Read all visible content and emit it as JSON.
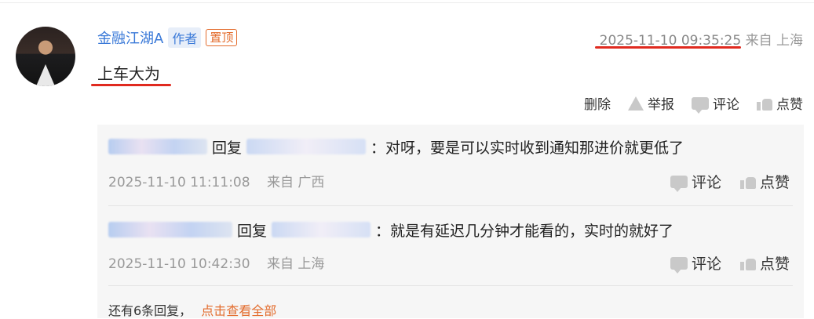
{
  "comment": {
    "author": "金融江湖A",
    "author_badge": "作者",
    "pinned_badge": "置顶",
    "time": "2025-11-10 09:35:25",
    "location": "来自 上海",
    "content": "上车大为",
    "actions": {
      "delete": "删除",
      "report": "举报",
      "comment": "评论",
      "like": "点赞"
    }
  },
  "replies": [
    {
      "user_partial": "邵 ... Kc 2C",
      "reply_word": "回复",
      "target_partial": "I ... ...",
      "text": "：对呀，要是可以实时收到通知那进价就更低了",
      "time": "2025-11-10 11:11:08",
      "location": "来自 广西",
      "comment_label": "评论",
      "like_label": "点赞"
    },
    {
      "user_partial": "股 ... 1 388 011",
      "reply_word": "回复",
      "target_partial": "股 ... 0",
      "text": "：就是有延迟几分钟才能看的，实时的就好了",
      "time": "2025-11-10 10:42:30",
      "location": "来自 上海",
      "comment_label": "评论",
      "like_label": "点赞"
    }
  ],
  "more_replies": {
    "text": "还有6条回复，",
    "link": "点击查看全部"
  },
  "colors": {
    "link_blue": "#3a79d8",
    "accent_orange": "#e36c2d",
    "underline_red": "#e02a1f"
  }
}
